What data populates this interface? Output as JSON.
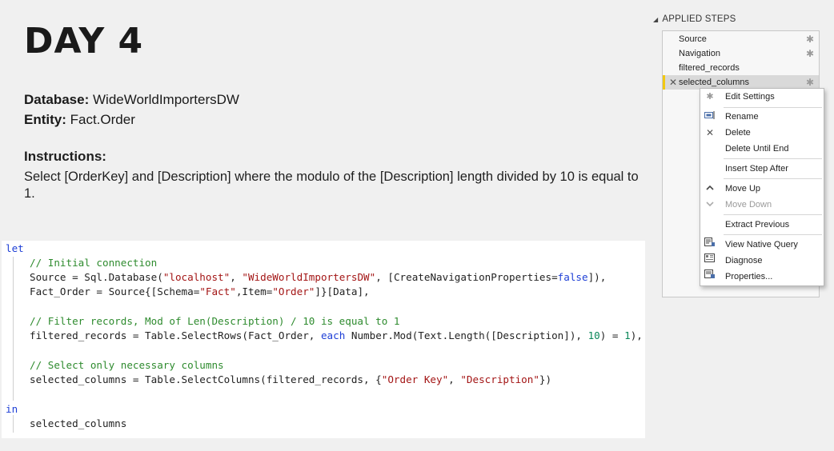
{
  "slide": {
    "title": "DAY 4",
    "database_label": "Database:",
    "database_value": "WideWorldImportersDW",
    "entity_label": "Entity:",
    "entity_value": "Fact.Order",
    "instructions_label": "Instructions:",
    "instructions_text": "Select [OrderKey] and [Description] where the modulo of the [Description] length divided by 10 is equal to 1."
  },
  "code": {
    "let": "let",
    "comment1": "// Initial connection",
    "source_lhs": "Source = Sql.Database(",
    "source_server": "\"localhost\"",
    "source_sep": ", ",
    "source_db": "\"WideWorldImportersDW\"",
    "source_rest1": ", [CreateNavigationProperties=",
    "source_false": "false",
    "source_rest2": "]),",
    "fact_lhs": "Fact_Order = Source{[Schema=",
    "fact_schema": "\"Fact\"",
    "fact_mid": ",Item=",
    "fact_item": "\"Order\"",
    "fact_rest": "]}[Data],",
    "comment2": "// Filter records, Mod of Len(Description) / 10 is equal to 1",
    "filter_lhs": "filtered_records = Table.SelectRows(Fact_Order, ",
    "filter_each": "each",
    "filter_mid": " Number.Mod(Text.Length([Description]), ",
    "filter_ten": "10",
    "filter_eq": ") = ",
    "filter_one": "1",
    "filter_end": "),",
    "comment3": "// Select only necessary columns",
    "select_lhs": "selected_columns = Table.SelectColumns(filtered_records, {",
    "select_c1": "\"Order Key\"",
    "select_sep": ", ",
    "select_c2": "\"Description\"",
    "select_end": "})",
    "in": "in",
    "result": "selected_columns"
  },
  "applied_steps": {
    "header": "APPLIED STEPS",
    "items": [
      {
        "label": "Source",
        "has_settings": true
      },
      {
        "label": "Navigation",
        "has_settings": true
      },
      {
        "label": "filtered_records",
        "has_settings": false
      },
      {
        "label": "selected_columns",
        "has_settings": true,
        "selected": true
      }
    ]
  },
  "context_menu": {
    "items": [
      {
        "label": "Edit Settings",
        "icon": "gear-icon",
        "enabled": true
      },
      {
        "label": "Rename",
        "icon": "rename-icon",
        "enabled": true
      },
      {
        "label": "Delete",
        "icon": "delete-x-icon",
        "enabled": true
      },
      {
        "label": "Delete Until End",
        "icon": "",
        "enabled": true
      },
      {
        "label": "Insert Step After",
        "icon": "",
        "enabled": true
      },
      {
        "label": "Move Up",
        "icon": "chevron-up-icon",
        "enabled": true
      },
      {
        "label": "Move Down",
        "icon": "chevron-down-icon",
        "enabled": false
      },
      {
        "label": "Extract Previous",
        "icon": "",
        "enabled": true
      },
      {
        "label": "View Native Query",
        "icon": "native-query-icon",
        "enabled": true
      },
      {
        "label": "Diagnose",
        "icon": "diagnose-icon",
        "enabled": true
      },
      {
        "label": "Properties...",
        "icon": "properties-icon",
        "enabled": true
      }
    ]
  },
  "colors": {
    "selected_step_accent": "#f2c811",
    "keyword": "#1e3fd6",
    "comment": "#2e8b2e",
    "string": "#a31515",
    "number": "#098658"
  }
}
